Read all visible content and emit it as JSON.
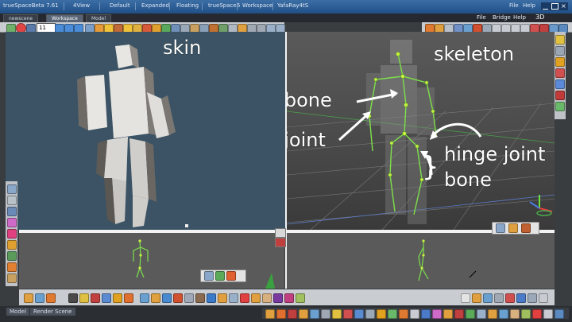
{
  "window": {
    "title": "trueSpaceBeta 7.61"
  },
  "top_menu": [
    "4View",
    "Default",
    "Expanded",
    "Floating",
    "trueSpace6",
    "Workspace",
    "YafaRay4tS"
  ],
  "top_right_menu": [
    "File",
    "Help"
  ],
  "tabs": {
    "scene": "newscene",
    "workspace": "Workspace",
    "model": "Model"
  },
  "right_menu": [
    "File",
    "Bridge",
    "Help"
  ],
  "right_3d": "3D",
  "frame_field": {
    "value": "11"
  },
  "annotations": {
    "skin": "skin",
    "skeleton": "skeleton",
    "nailed_bone": "nailed bone",
    "fixed_joint": "fixed joint",
    "hinge_joint": "hinge joint",
    "bone": "bone"
  },
  "status_tabs": [
    "Model",
    "Render Scene"
  ],
  "colors": {
    "accent_green": "#6fe045",
    "menu_blue": "#2a5d96",
    "viewport_blue": "#3b5364"
  }
}
